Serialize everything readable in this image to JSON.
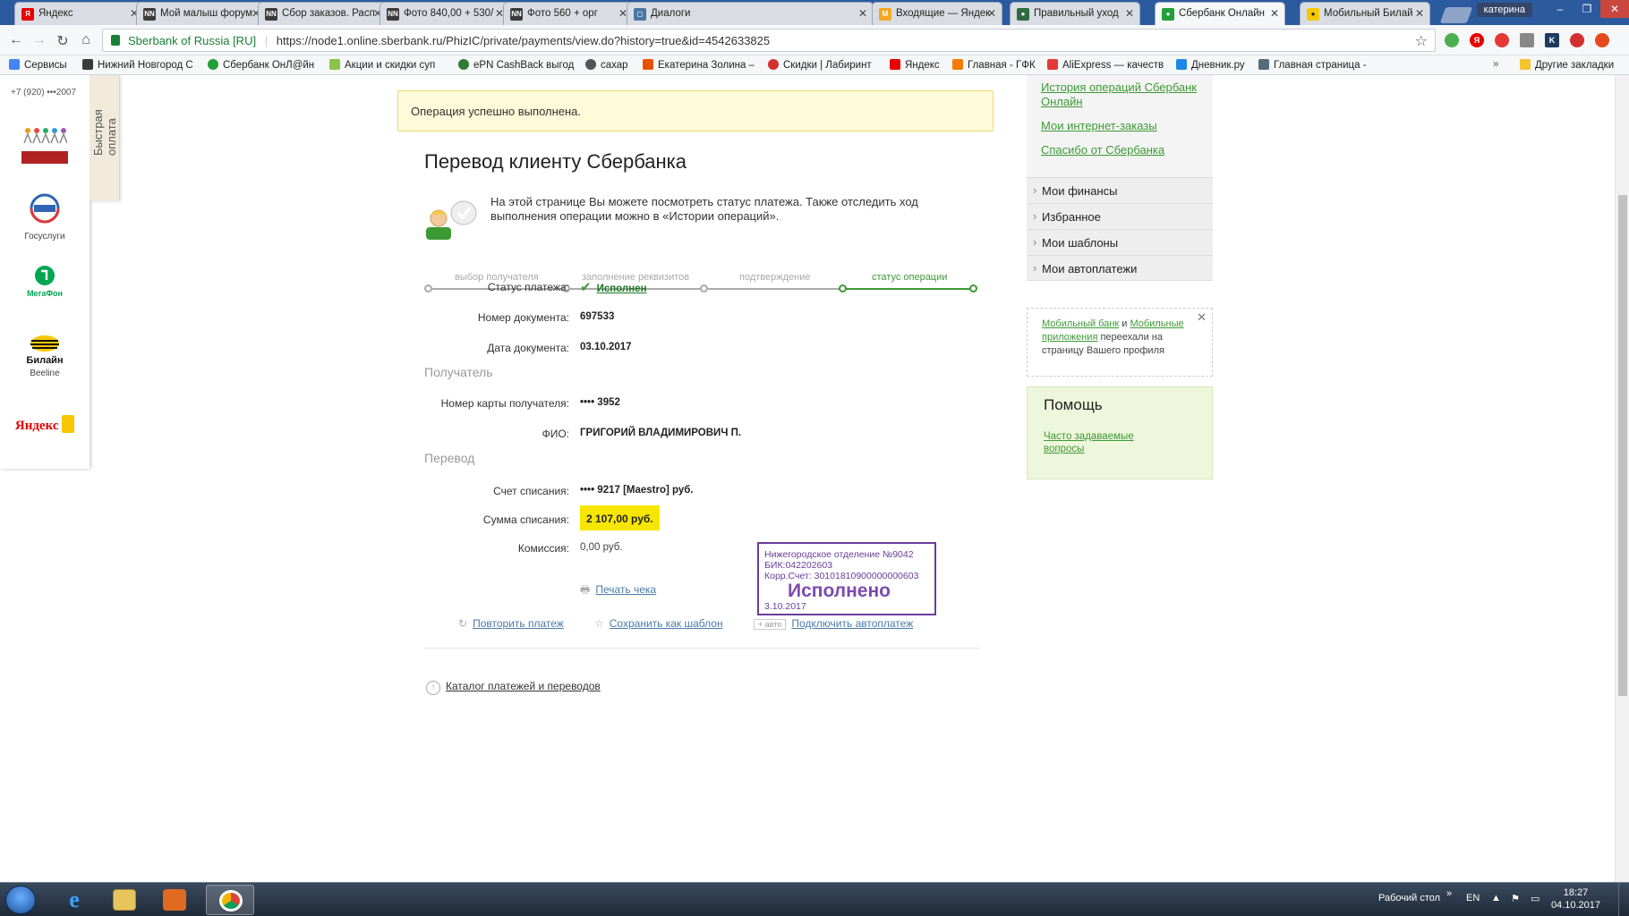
{
  "tabs": [
    {
      "title": "Яндекс",
      "fav_text": "Я",
      "fav_color": "#e60000"
    },
    {
      "title": "Мой малыш форум",
      "fav_text": "NN",
      "fav_color": "#3b3b3b"
    },
    {
      "title": "Сбор заказов. Расп",
      "fav_text": "NN",
      "fav_color": "#3b3b3b"
    },
    {
      "title": "Фото 840,00 + 530/",
      "fav_text": "NN",
      "fav_color": "#3b3b3b"
    },
    {
      "title": "Фото 560 + орг",
      "fav_text": "NN",
      "fav_color": "#3b3b3b"
    },
    {
      "title": "Диалоги",
      "fav_text": "◻",
      "fav_color": "#4a76a8"
    },
    {
      "title": "Входящие — Яндек",
      "fav_text": "M",
      "fav_color": "#f5a623"
    },
    {
      "title": "Правильный уход",
      "fav_text": "●",
      "fav_color": "#2e6b3e"
    },
    {
      "title": "Сбербанк Онлайн",
      "fav_text": "●",
      "fav_color": "#21a038"
    },
    {
      "title": "Мобильный Билай",
      "fav_text": "●",
      "fav_color": "#f7c800"
    }
  ],
  "window_user": "катерина",
  "address": {
    "secure_label": "Sberbank of Russia [RU]",
    "url": "https://node1.online.sberbank.ru/PhizIC/private/payments/view.do?history=true&id=4542633825"
  },
  "bookmarks": [
    {
      "label": "Сервисы",
      "color": "#4285f4"
    },
    {
      "label": "Нижний Новгород С",
      "color": "#3b3b3b"
    },
    {
      "label": "Сбербанк ОнЛ@йн",
      "color": "#21a038"
    },
    {
      "label": "Акции и скидки суп",
      "color": "#8bc34a"
    },
    {
      "label": "ePN CashBack выгод",
      "color": "#2e7d32"
    },
    {
      "label": "сахар",
      "color": "#555555"
    },
    {
      "label": "Екатерина Золина –",
      "color": "#e65100"
    },
    {
      "label": "Скидки | Лабиринт",
      "color": "#d32f2f"
    },
    {
      "label": "Яндекс",
      "color": "#e60000"
    },
    {
      "label": "Главная - ГФК",
      "color": "#f57c00"
    },
    {
      "label": "AliExpress — качеств",
      "color": "#e53935"
    },
    {
      "label": "Дневник.ру",
      "color": "#1e88e5"
    },
    {
      "label": "Главная страница -",
      "color": "#546e7a"
    }
  ],
  "bookmarks_other": "Другие закладки",
  "sidebar_partners": {
    "phone": "+7 (920) •••2007",
    "gosuslugi_label": "Госуслуги",
    "megafon_label": "МегаФон",
    "beeline_logo": "Билайн",
    "beeline_label": "Beeline",
    "yandex_label": "Яндекс",
    "quickpay_label": "Быстрая оплата"
  },
  "success_message": "Операция успешно выполнена.",
  "page_title": "Перевод клиенту Сбербанка",
  "intro_text": "На этой странице Вы можете посмотреть статус платежа. Также отследить ход выполнения операции можно в «Истории операций».",
  "steps": [
    "выбор получателя",
    "заполнение реквизитов",
    "подтверждение",
    "статус операции"
  ],
  "details": {
    "status_label": "Статус платежа:",
    "status_value": "Исполнен",
    "doc_number_label": "Номер документа:",
    "doc_number": "697533",
    "doc_date_label": "Дата документа:",
    "doc_date": "03.10.2017",
    "recipient_section": "Получатель",
    "card_label": "Номер карты получателя:",
    "card_value": "•••• 3952",
    "fio_label": "ФИО:",
    "fio_value": "ГРИГОРИЙ ВЛАДИМИРОВИЧ П.",
    "transfer_section": "Перевод",
    "account_label": "Счет списания:",
    "account_value": "•••• 9217  [Maestro]  руб.",
    "amount_label": "Сумма списания:",
    "amount_value": "2 107,00  руб.",
    "commission_label": "Комиссия:",
    "commission_value": "0,00 руб."
  },
  "stamp": {
    "line1": "Нижегородское отделение №9042",
    "line2": "БИК:042202603",
    "line3": "Корр.Счет: 30101810900000000603",
    "big": "Исполнено",
    "date": "3.10.2017"
  },
  "actions": {
    "print": "Печать чека",
    "repeat": "Повторить платеж",
    "save_template": "Сохранить как шаблон",
    "auto_badge": "+ авто",
    "autopay": "Подключить автоплатеж",
    "catalog": "Каталог платежей и переводов"
  },
  "right_sidebar": {
    "links": [
      "История операций Сбербанк Онлайн",
      "Мои интернет-заказы",
      "Спасибо от Сбербанка"
    ],
    "menu": [
      "Мои финансы",
      "Избранное",
      "Мои шаблоны",
      "Мои автоплатежи"
    ],
    "note_link1": "Мобильный банк",
    "note_and": " и ",
    "note_link2": "Мобильные приложения",
    "note_rest": " переехали на страницу Вашего профиля",
    "help_title": "Помощь",
    "help_link": "Часто задаваемые вопросы"
  },
  "taskbar": {
    "desktop_label": "Рабочий стол",
    "lang": "EN",
    "time": "18:27",
    "date": "04.10.2017"
  },
  "colors": {
    "accent_green": "#3c9a35",
    "highlight_yellow": "#f7e600",
    "stamp_purple": "#6a3d9a"
  }
}
